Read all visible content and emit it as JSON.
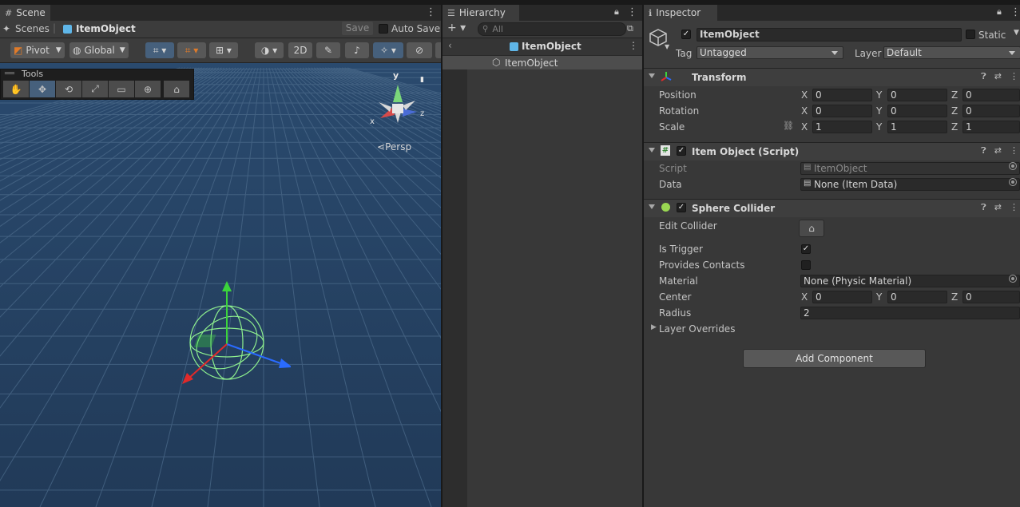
{
  "scene": {
    "tab_label": "Scene",
    "breadcrumb_scenes": "Scenes",
    "breadcrumb_object": "ItemObject",
    "save_label": "Save",
    "autosave_label": "Auto Save",
    "pivot_label": "Pivot",
    "global_label": "Global",
    "mode_2d_label": "2D",
    "tools_label": "Tools",
    "gizmo_y": "y",
    "gizmo_x": "x",
    "gizmo_z": "z",
    "persp_label": "Persp"
  },
  "hierarchy": {
    "tab_label": "Hierarchy",
    "search_placeholder": "All",
    "scene_header": "ItemObject",
    "items": [
      {
        "label": "ItemObject"
      }
    ]
  },
  "inspector": {
    "tab_label": "Inspector",
    "object_name": "ItemObject",
    "static_label": "Static",
    "tag_label": "Tag",
    "tag_value": "Untagged",
    "layer_label": "Layer",
    "layer_value": "Default",
    "transform": {
      "title": "Transform",
      "position_label": "Position",
      "rotation_label": "Rotation",
      "scale_label": "Scale",
      "axis_x": "X",
      "axis_y": "Y",
      "axis_z": "Z",
      "position": {
        "x": "0",
        "y": "0",
        "z": "0"
      },
      "rotation": {
        "x": "0",
        "y": "0",
        "z": "0"
      },
      "scale": {
        "x": "1",
        "y": "1",
        "z": "1"
      }
    },
    "script_component": {
      "title": "Item Object (Script)",
      "script_label": "Script",
      "script_value": "ItemObject",
      "data_label": "Data",
      "data_value": "None (Item Data)"
    },
    "sphere_collider": {
      "title": "Sphere Collider",
      "edit_collider_label": "Edit Collider",
      "is_trigger_label": "Is Trigger",
      "is_trigger": true,
      "provides_contacts_label": "Provides Contacts",
      "provides_contacts": false,
      "material_label": "Material",
      "material_value": "None (Physic Material)",
      "center_label": "Center",
      "center": {
        "x": "0",
        "y": "0",
        "z": "0"
      },
      "radius_label": "Radius",
      "radius_value": "2",
      "layer_overrides_label": "Layer Overrides"
    },
    "add_component_label": "Add Component"
  },
  "colors": {
    "accent_blue": "#46607c",
    "viewport_bg": "#243f5e",
    "axis_x": "#e02a2a",
    "axis_y": "#3bd43b",
    "axis_z": "#2a6bff"
  }
}
